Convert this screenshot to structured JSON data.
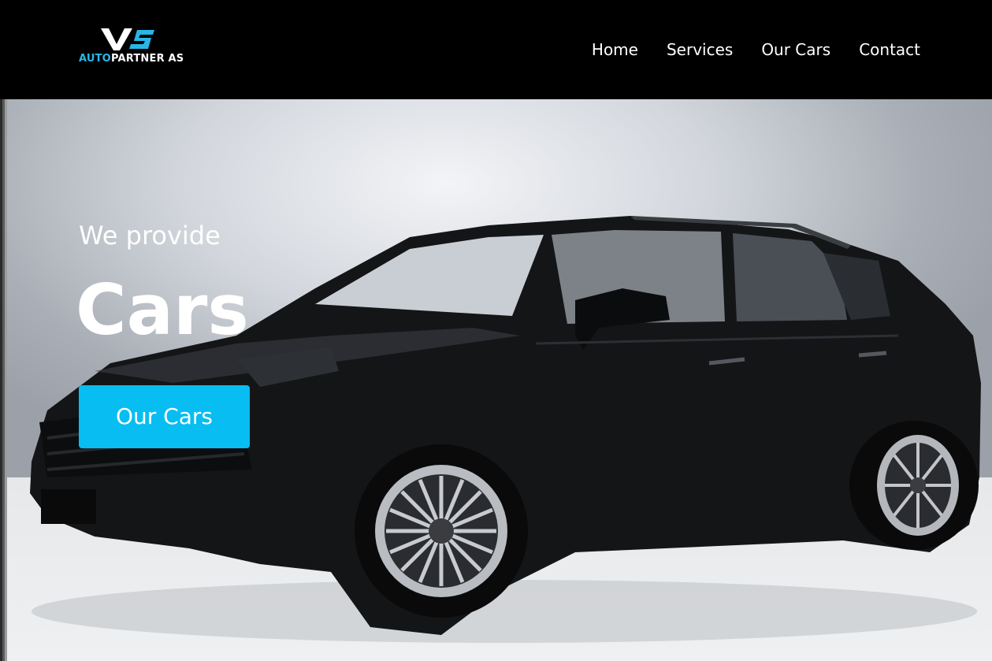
{
  "logo": {
    "brand_auto": "AUTO",
    "brand_partner": "PARTNER AS"
  },
  "nav": {
    "items": [
      "Home",
      "Services",
      "Our Cars",
      "Contact"
    ]
  },
  "hero": {
    "subtitle": "We provide",
    "title": "Cars",
    "cta_label": "Our Cars"
  },
  "colors": {
    "accent": "#08bdf1",
    "logo_blue": "#29b6e6",
    "navbar_bg": "#000000"
  }
}
